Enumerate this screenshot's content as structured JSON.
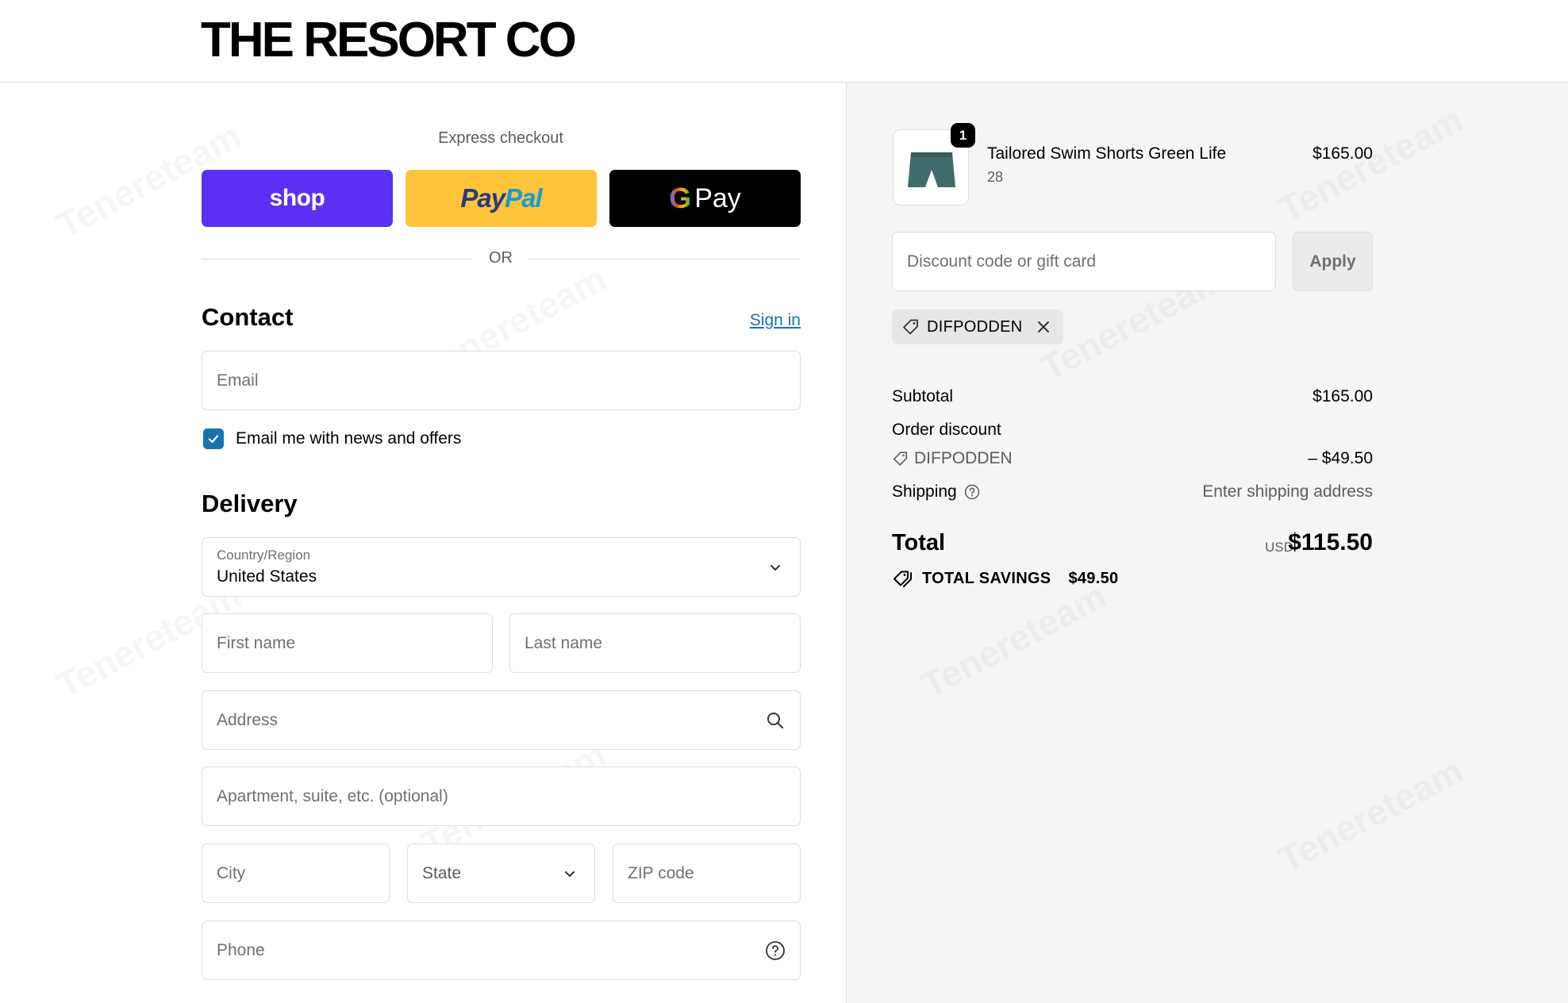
{
  "brand": {
    "name": "THE RESORT CO"
  },
  "express": {
    "label": "Express checkout",
    "shop_label": "shop",
    "paypal_part1": "Pay",
    "paypal_part2": "Pal",
    "gpay_g": "G",
    "gpay_label": "Pay",
    "or_label": "OR"
  },
  "contact": {
    "title": "Contact",
    "signin_label": "Sign in",
    "email_placeholder": "Email",
    "newsletter_label": "Email me with news and offers",
    "newsletter_checked": true
  },
  "delivery": {
    "title": "Delivery",
    "country_label": "Country/Region",
    "country_value": "United States",
    "first_name_placeholder": "First name",
    "last_name_placeholder": "Last name",
    "address_placeholder": "Address",
    "apartment_placeholder": "Apartment, suite, etc. (optional)",
    "city_placeholder": "City",
    "state_placeholder": "State",
    "zip_placeholder": "ZIP code",
    "phone_placeholder": "Phone"
  },
  "cart": {
    "item": {
      "quantity": "1",
      "name": "Tailored Swim Shorts Green Life",
      "variant": "28",
      "price": "$165.00",
      "image_icon": "swim-shorts-image"
    },
    "discount_placeholder": "Discount code or gift card",
    "apply_label": "Apply",
    "applied_code": "DIFPODDEN"
  },
  "summary": {
    "subtotal_label": "Subtotal",
    "subtotal_value": "$165.00",
    "order_discount_label": "Order discount",
    "discount_code": "DIFPODDEN",
    "discount_value": "– $49.50",
    "shipping_label": "Shipping",
    "shipping_value": "Enter shipping address",
    "total_label": "Total",
    "total_currency": "USD",
    "total_value": "$115.50",
    "savings_label": "TOTAL SAVINGS",
    "savings_value": "$49.50"
  },
  "colors": {
    "shop": "#5a31f4",
    "paypal": "#ffc439",
    "gpay": "#000000",
    "link": "#1773b0",
    "checkbox": "#1773b0",
    "summary_bg": "#f5f5f5"
  },
  "watermark": "Tenereteam"
}
